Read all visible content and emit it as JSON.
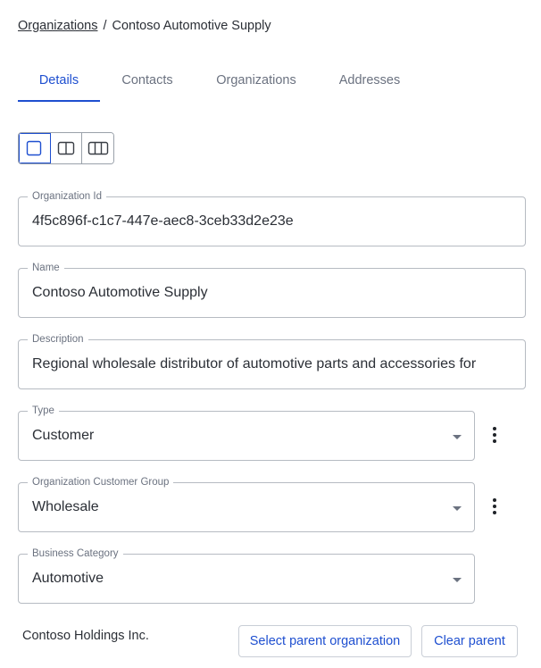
{
  "breadcrumb": {
    "root": "Organizations",
    "separator": "/",
    "current": "Contoso Automotive Supply"
  },
  "tabs": [
    {
      "label": "Details",
      "active": true
    },
    {
      "label": "Contacts",
      "active": false
    },
    {
      "label": "Organizations",
      "active": false
    },
    {
      "label": "Addresses",
      "active": false
    }
  ],
  "layout_toggle": {
    "options": [
      "single-column-icon",
      "two-column-icon",
      "three-column-icon"
    ],
    "selected": "single-column-icon"
  },
  "fields": {
    "organization_id": {
      "label": "Organization Id",
      "value": "4f5c896f-c1c7-447e-aec8-3ceb33d2e23e"
    },
    "name": {
      "label": "Name",
      "value": "Contoso Automotive Supply"
    },
    "description": {
      "label": "Description",
      "value": "Regional wholesale distributor of automotive parts and accessories for"
    },
    "type": {
      "label": "Type",
      "value": "Customer"
    },
    "customer_group": {
      "label": "Organization Customer Group",
      "value": "Wholesale"
    },
    "business_category": {
      "label": "Business Category",
      "value": "Automotive"
    }
  },
  "parent": {
    "name": "Contoso Holdings Inc.",
    "select_label": "Select parent organization",
    "clear_label": "Clear parent"
  },
  "colors": {
    "accent": "#1e4fd0",
    "border": "#b6bbc2",
    "muted_text": "#6b7280"
  }
}
